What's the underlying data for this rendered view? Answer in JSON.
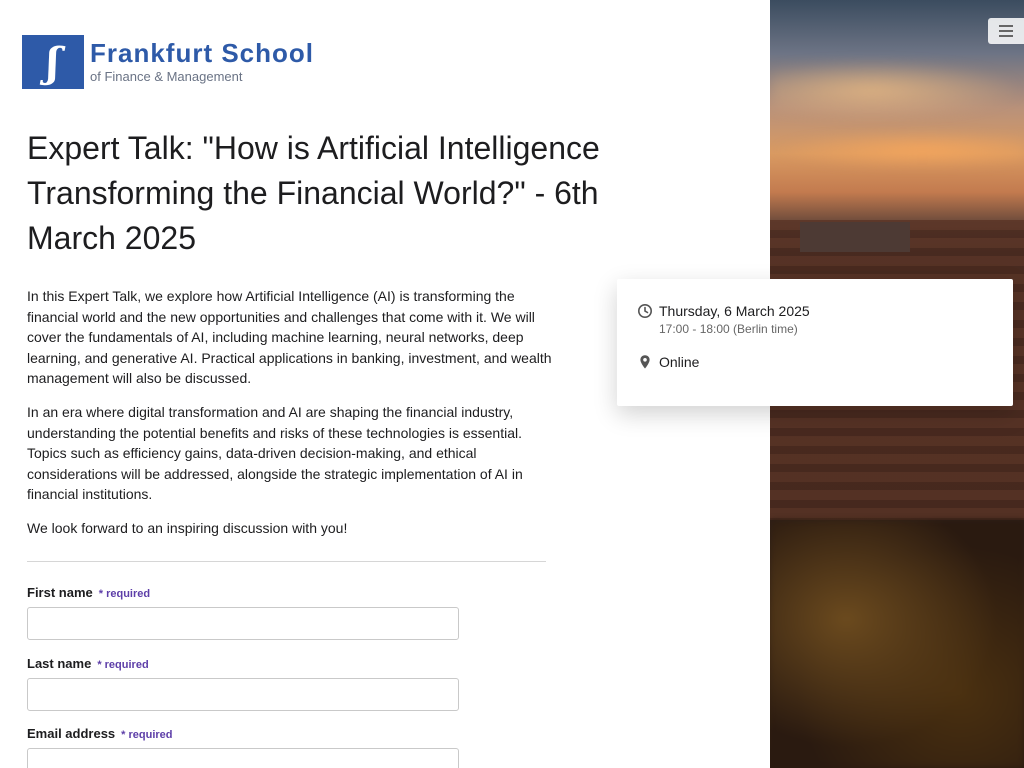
{
  "logo": {
    "name": "Frankfurt School",
    "subtitle": "of Finance & Management"
  },
  "page": {
    "title": "Expert Talk: \"How is Artificial Intelligence Transforming the Financial World?\" - 6th March 2025",
    "paragraphs": [
      "In this Expert Talk, we explore how Artificial Intelligence (AI) is transforming the financial world and the new opportunities and challenges that come with it. We will cover the fundamentals of AI, including machine learning, neural networks, deep learning, and generative AI. Practical applications in banking, investment, and wealth management will also be discussed.",
      "In an era where digital transformation and AI are shaping the financial industry, understanding the potential benefits and risks of these technologies is essential. Topics such as efficiency gains, data-driven decision-making, and ethical considerations will be addressed, alongside the strategic implementation of AI in financial institutions.",
      "We look forward to an inspiring discussion with you!"
    ]
  },
  "form": {
    "required_label": "* required",
    "first_name_label": "First name",
    "first_name_value": "",
    "last_name_label": "Last name",
    "last_name_value": "",
    "email_label": "Email address",
    "email_value": ""
  },
  "event": {
    "date": "Thursday, 6 March 2025",
    "time": "17:00 - 18:00 (Berlin time)",
    "location": "Online",
    "clock_icon": "clock-icon",
    "location_icon": "map-pin-icon"
  },
  "colors": {
    "brand_blue": "#2e5aa8",
    "required_purple": "#5d3ea8",
    "text": "#1d1d1f"
  }
}
